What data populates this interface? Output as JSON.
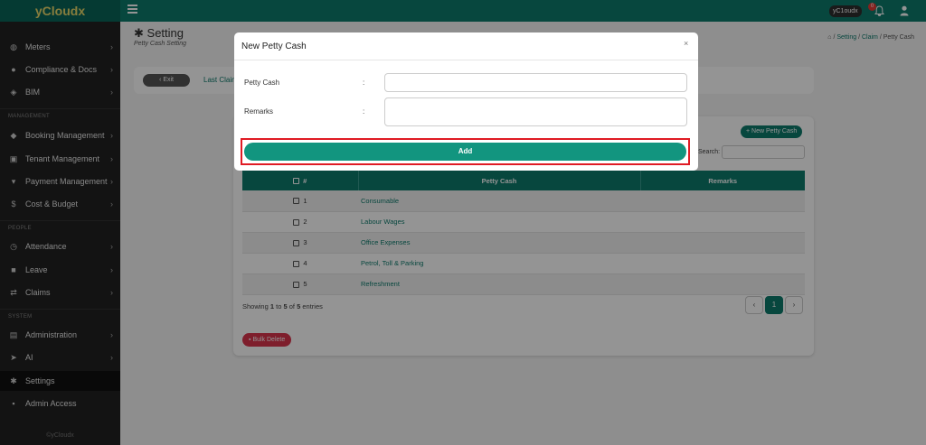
{
  "app": {
    "brand": "yCloudx",
    "user": "yC1oudx",
    "notifications": "0",
    "footer": "©yCloudx"
  },
  "sidebar": {
    "items": [
      {
        "label": "Meters",
        "icon": "gauge-icon"
      },
      {
        "label": "Compliance & Docs",
        "icon": "circle-icon"
      },
      {
        "label": "BIM",
        "icon": "cube-icon"
      },
      {
        "label": "Booking Management",
        "icon": "tag-icon"
      },
      {
        "label": "Tenant Management",
        "icon": "building-icon"
      },
      {
        "label": "Payment Management",
        "icon": "cart-icon"
      },
      {
        "label": "Cost & Budget",
        "icon": "dollar-icon"
      },
      {
        "label": "Attendance",
        "icon": "clock-icon"
      },
      {
        "label": "Leave",
        "icon": "briefcase-icon"
      },
      {
        "label": "Claims",
        "icon": "exchange-icon"
      },
      {
        "label": "Administration",
        "icon": "user-card-icon"
      },
      {
        "label": "AI",
        "icon": "plane-icon"
      },
      {
        "label": "Settings",
        "icon": "gear-icon"
      },
      {
        "label": "Admin Access",
        "icon": "lock-icon"
      }
    ],
    "sections": {
      "management": "MANAGEMENT",
      "people": "PEOPLE",
      "system": "SYSTEM"
    }
  },
  "page": {
    "title": "Setting",
    "subtitle": "Petty Cash Setting",
    "breadcrumb": {
      "s1": "Setting",
      "s2": "Claim",
      "s3": "Petty Cash",
      "sep": "/"
    }
  },
  "toolbar": {
    "exit_label": "Exit",
    "last_claim_label": "Last Claim"
  },
  "card": {
    "new_button": "New Petty Cash",
    "search_label": "Search:",
    "columns": {
      "no": "#",
      "petty_cash": "Petty Cash",
      "remarks": "Remarks"
    },
    "rows": [
      {
        "no": "1",
        "petty_cash": "Consumable",
        "remarks": ""
      },
      {
        "no": "2",
        "petty_cash": "Labour Wages",
        "remarks": ""
      },
      {
        "no": "3",
        "petty_cash": "Office Expenses",
        "remarks": ""
      },
      {
        "no": "4",
        "petty_cash": "Petrol, Toll & Parking",
        "remarks": ""
      },
      {
        "no": "5",
        "petty_cash": "Refreshment",
        "remarks": ""
      }
    ],
    "showing_prefix": "Showing",
    "showing_from": "1",
    "showing_to": "5",
    "showing_of": "5",
    "showing_suffix": "entries",
    "page_current": "1",
    "bulk_delete": "Bulk Delete"
  },
  "modal": {
    "title": "New Petty Cash",
    "close": "×",
    "petty_cash_label": "Petty Cash",
    "remarks_label": "Remarks",
    "colon": ":",
    "petty_cash_value": "",
    "remarks_value": "",
    "add_label": "Add"
  },
  "colors": {
    "accent": "#0d7a6c",
    "highlight": "#e01b24",
    "danger": "#d9344d"
  }
}
